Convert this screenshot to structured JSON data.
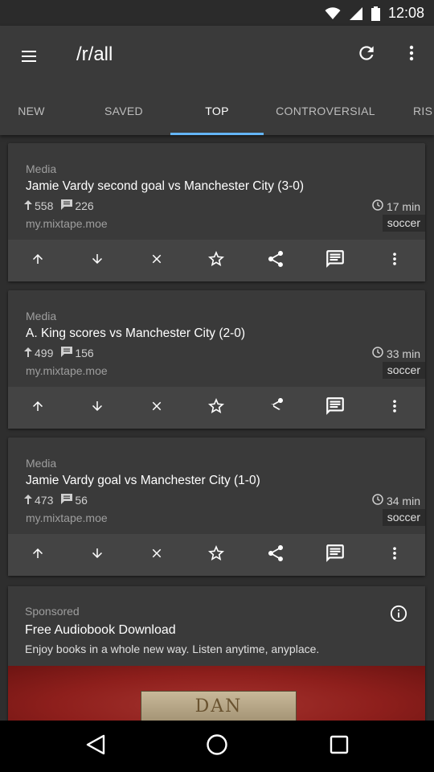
{
  "status_bar": {
    "time": "12:08"
  },
  "app_bar": {
    "title": "/r/all",
    "tabs": [
      {
        "label": "NEW"
      },
      {
        "label": "SAVED"
      },
      {
        "label": "TOP"
      },
      {
        "label": "CONTROVERSIAL"
      },
      {
        "label": "RIS"
      }
    ],
    "active_tab": "TOP",
    "accent": "#64b5f6"
  },
  "posts": [
    {
      "type": "Media",
      "title": "Jamie Vardy second goal vs Manchester City (3-0)",
      "score": "558",
      "comments": "226",
      "domain": "my.mixtape.moe",
      "age": "17 min",
      "flair": "soccer"
    },
    {
      "type": "Media",
      "title": "A. King scores vs Manchester City (2-0)",
      "score": "499",
      "comments": "156",
      "domain": "my.mixtape.moe",
      "age": "33 min",
      "flair": "soccer"
    },
    {
      "type": "Media",
      "title": "Jamie Vardy goal vs Manchester City (1-0)",
      "score": "473",
      "comments": "56",
      "domain": "my.mixtape.moe",
      "age": "34 min",
      "flair": "soccer"
    }
  ],
  "actions": [
    "arrow-up-icon",
    "arrow-down-icon",
    "close-icon",
    "star-icon",
    "share-icon",
    "comment-icon",
    "more-vert-icon"
  ],
  "ad": {
    "label": "Sponsored",
    "title": "Free Audiobook Download",
    "description": "Enjoy books in a whole new way. Listen anytime, anyplace.",
    "image_text": "DAN"
  },
  "colors": {
    "background": "#2e2e2e",
    "card": "#3a3a3a",
    "app_bar": "#3a3a3a"
  }
}
